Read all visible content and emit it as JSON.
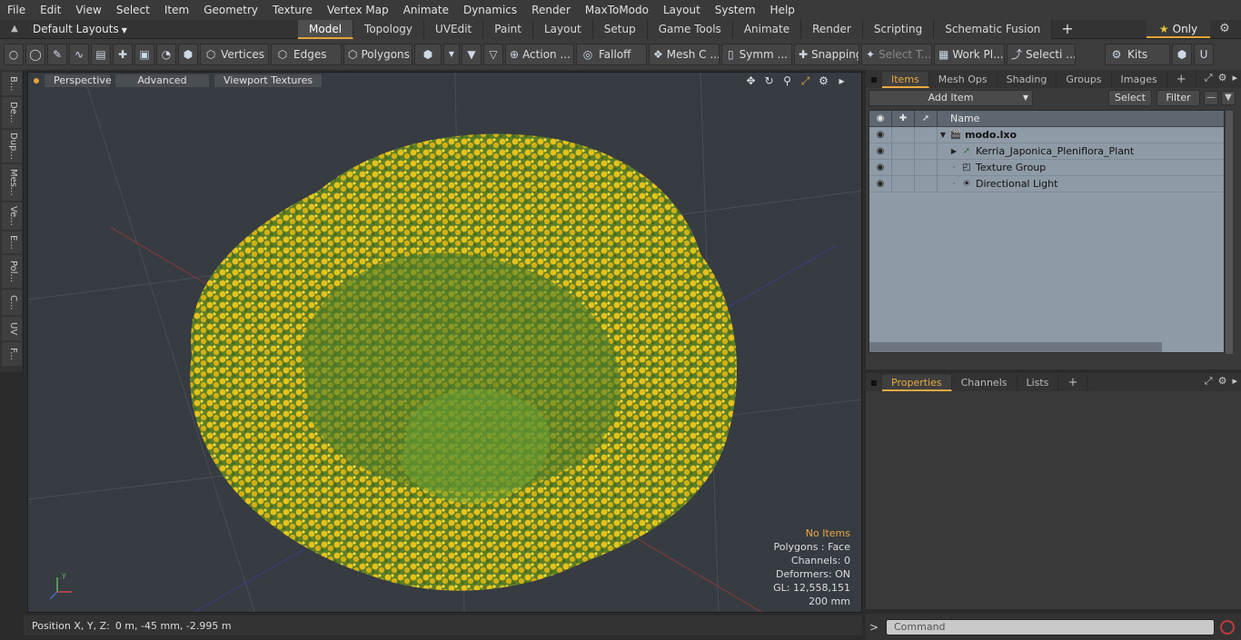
{
  "menu": [
    "File",
    "Edit",
    "View",
    "Select",
    "Item",
    "Geometry",
    "Texture",
    "Vertex Map",
    "Animate",
    "Dynamics",
    "Render",
    "MaxToModo",
    "Layout",
    "System",
    "Help"
  ],
  "layoutbar": {
    "default_layouts": "Default Layouts",
    "tabs": [
      "Model",
      "Topology",
      "UVEdit",
      "Paint",
      "Layout",
      "Setup",
      "Game Tools",
      "Animate",
      "Render",
      "Scripting",
      "Schematic Fusion"
    ],
    "active_tab": "Model",
    "only_label": "Only"
  },
  "toolbar": {
    "vertices": "Vertices",
    "edges": "Edges",
    "polygons": "Polygons",
    "action": "Action ...",
    "falloff": "Falloff",
    "mesh": "Mesh C ...",
    "symm": "Symm ...",
    "snapping": "Snapping",
    "select_t": "Select T...",
    "work_pl": "Work Pl...",
    "selecti": "Selecti ...",
    "kits": "Kits"
  },
  "leftstrip": [
    "B...",
    "De...",
    "Dup...",
    "Mes...",
    "Ve...",
    "E...",
    "Pol...",
    "C...",
    "UV",
    "F..."
  ],
  "viewport": {
    "perspective": "Perspective",
    "advanced": "Advanced",
    "viewport_textures": "Viewport Textures",
    "info": {
      "no_items": "No Items",
      "polygons": "Polygons : Face",
      "channels": "Channels: 0",
      "deformers": "Deformers: ON",
      "gl": "GL: 12,558,151",
      "scale": "200 mm"
    }
  },
  "statusbar": {
    "label": "Position X, Y, Z:",
    "value": "0 m, -45 mm, -2.995 m"
  },
  "items_panel": {
    "tabs": [
      "Items",
      "Mesh Ops",
      "Shading",
      "Groups",
      "Images"
    ],
    "active_tab": "Items",
    "add_item": "Add Item",
    "select": "Select",
    "filter": "Filter",
    "name_col": "Name",
    "rows": [
      {
        "label": "modo.lxo"
      },
      {
        "label": "Kerria_Japonica_Pleniflora_Plant"
      },
      {
        "label": "Texture Group"
      },
      {
        "label": "Directional Light"
      }
    ]
  },
  "props_panel": {
    "tabs": [
      "Properties",
      "Channels",
      "Lists"
    ],
    "active_tab": "Properties"
  },
  "command": {
    "prompt": ">",
    "placeholder": "Command"
  }
}
